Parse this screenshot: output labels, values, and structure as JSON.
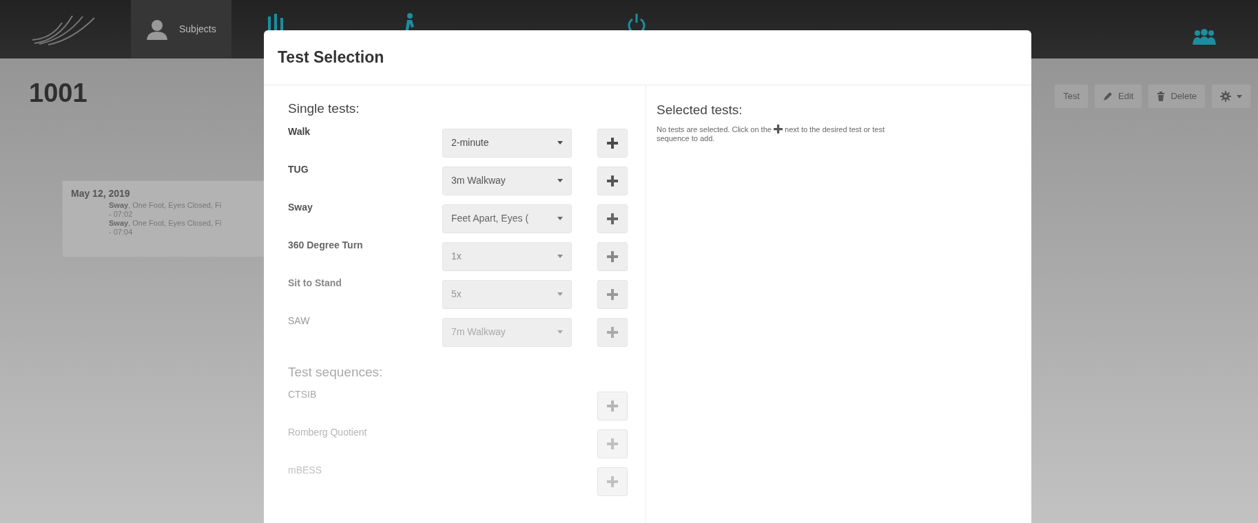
{
  "nav": {
    "items": [
      {
        "label": "Subjects",
        "selected": true
      }
    ]
  },
  "subject": {
    "title": "1001",
    "actions": [
      {
        "kind": "test",
        "label": "Test"
      },
      {
        "kind": "edit",
        "label": "Edit"
      },
      {
        "kind": "delete",
        "label": "Delete"
      },
      {
        "kind": "settings"
      }
    ]
  },
  "sessions": [
    {
      "date": "May 12, 2019",
      "entries": [
        {
          "text": "**Sway**, One Foot, Eyes Closed, Fi",
          "time": "- 07:02"
        },
        {
          "text": "**Sway**, One Foot, Eyes Closed, Fi",
          "time": "- 07:04"
        }
      ]
    }
  ],
  "modal": {
    "title": "Test Selection",
    "single_tests": {
      "heading": "Single tests:",
      "items": [
        {
          "label": "Walk",
          "option": "2-minute"
        },
        {
          "label": "TUG",
          "option": "3m Walkway"
        },
        {
          "label": "Sway",
          "option": "Feet Apart, Eyes ("
        },
        {
          "label": "360 Degree Turn",
          "option": "1x"
        },
        {
          "label": "Sit to Stand",
          "option": "5x"
        },
        {
          "label": "SAW",
          "option": "7m Walkway"
        }
      ]
    },
    "test_sequences": {
      "heading": "Test sequences:",
      "items": [
        {
          "label": "CTSIB"
        },
        {
          "label": "Romberg Quotient"
        },
        {
          "label": "mBESS"
        }
      ]
    },
    "selected_tests": {
      "heading": "Selected tests:",
      "message_before": "No tests are selected. Click on the",
      "message_after": "next to the desired test or test",
      "message_end": "sequence to add."
    }
  }
}
